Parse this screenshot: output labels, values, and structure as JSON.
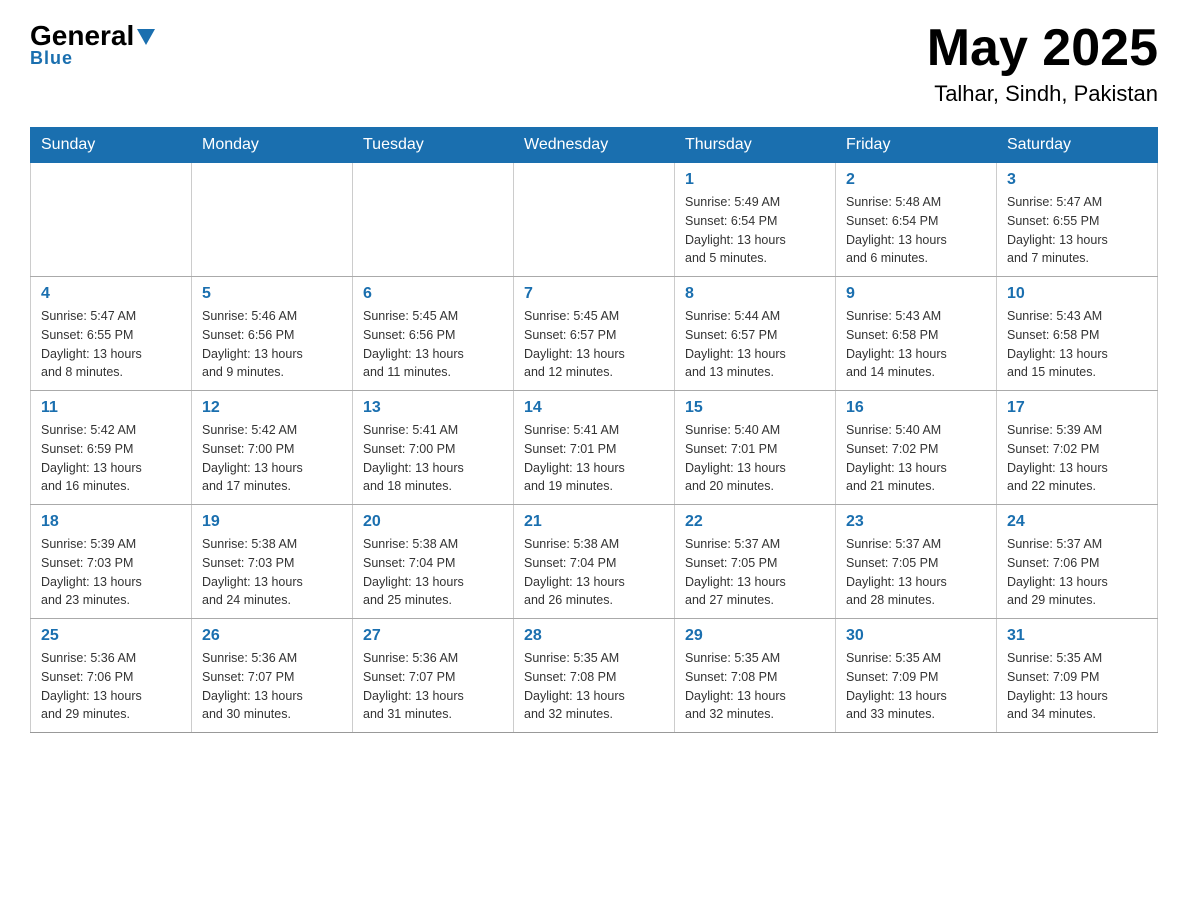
{
  "header": {
    "logo_general": "General",
    "logo_blue": "Blue",
    "month_year": "May 2025",
    "location": "Talhar, Sindh, Pakistan"
  },
  "calendar": {
    "days_of_week": [
      "Sunday",
      "Monday",
      "Tuesday",
      "Wednesday",
      "Thursday",
      "Friday",
      "Saturday"
    ],
    "weeks": [
      [
        {
          "day": "",
          "info": ""
        },
        {
          "day": "",
          "info": ""
        },
        {
          "day": "",
          "info": ""
        },
        {
          "day": "",
          "info": ""
        },
        {
          "day": "1",
          "info": "Sunrise: 5:49 AM\nSunset: 6:54 PM\nDaylight: 13 hours\nand 5 minutes."
        },
        {
          "day": "2",
          "info": "Sunrise: 5:48 AM\nSunset: 6:54 PM\nDaylight: 13 hours\nand 6 minutes."
        },
        {
          "day": "3",
          "info": "Sunrise: 5:47 AM\nSunset: 6:55 PM\nDaylight: 13 hours\nand 7 minutes."
        }
      ],
      [
        {
          "day": "4",
          "info": "Sunrise: 5:47 AM\nSunset: 6:55 PM\nDaylight: 13 hours\nand 8 minutes."
        },
        {
          "day": "5",
          "info": "Sunrise: 5:46 AM\nSunset: 6:56 PM\nDaylight: 13 hours\nand 9 minutes."
        },
        {
          "day": "6",
          "info": "Sunrise: 5:45 AM\nSunset: 6:56 PM\nDaylight: 13 hours\nand 11 minutes."
        },
        {
          "day": "7",
          "info": "Sunrise: 5:45 AM\nSunset: 6:57 PM\nDaylight: 13 hours\nand 12 minutes."
        },
        {
          "day": "8",
          "info": "Sunrise: 5:44 AM\nSunset: 6:57 PM\nDaylight: 13 hours\nand 13 minutes."
        },
        {
          "day": "9",
          "info": "Sunrise: 5:43 AM\nSunset: 6:58 PM\nDaylight: 13 hours\nand 14 minutes."
        },
        {
          "day": "10",
          "info": "Sunrise: 5:43 AM\nSunset: 6:58 PM\nDaylight: 13 hours\nand 15 minutes."
        }
      ],
      [
        {
          "day": "11",
          "info": "Sunrise: 5:42 AM\nSunset: 6:59 PM\nDaylight: 13 hours\nand 16 minutes."
        },
        {
          "day": "12",
          "info": "Sunrise: 5:42 AM\nSunset: 7:00 PM\nDaylight: 13 hours\nand 17 minutes."
        },
        {
          "day": "13",
          "info": "Sunrise: 5:41 AM\nSunset: 7:00 PM\nDaylight: 13 hours\nand 18 minutes."
        },
        {
          "day": "14",
          "info": "Sunrise: 5:41 AM\nSunset: 7:01 PM\nDaylight: 13 hours\nand 19 minutes."
        },
        {
          "day": "15",
          "info": "Sunrise: 5:40 AM\nSunset: 7:01 PM\nDaylight: 13 hours\nand 20 minutes."
        },
        {
          "day": "16",
          "info": "Sunrise: 5:40 AM\nSunset: 7:02 PM\nDaylight: 13 hours\nand 21 minutes."
        },
        {
          "day": "17",
          "info": "Sunrise: 5:39 AM\nSunset: 7:02 PM\nDaylight: 13 hours\nand 22 minutes."
        }
      ],
      [
        {
          "day": "18",
          "info": "Sunrise: 5:39 AM\nSunset: 7:03 PM\nDaylight: 13 hours\nand 23 minutes."
        },
        {
          "day": "19",
          "info": "Sunrise: 5:38 AM\nSunset: 7:03 PM\nDaylight: 13 hours\nand 24 minutes."
        },
        {
          "day": "20",
          "info": "Sunrise: 5:38 AM\nSunset: 7:04 PM\nDaylight: 13 hours\nand 25 minutes."
        },
        {
          "day": "21",
          "info": "Sunrise: 5:38 AM\nSunset: 7:04 PM\nDaylight: 13 hours\nand 26 minutes."
        },
        {
          "day": "22",
          "info": "Sunrise: 5:37 AM\nSunset: 7:05 PM\nDaylight: 13 hours\nand 27 minutes."
        },
        {
          "day": "23",
          "info": "Sunrise: 5:37 AM\nSunset: 7:05 PM\nDaylight: 13 hours\nand 28 minutes."
        },
        {
          "day": "24",
          "info": "Sunrise: 5:37 AM\nSunset: 7:06 PM\nDaylight: 13 hours\nand 29 minutes."
        }
      ],
      [
        {
          "day": "25",
          "info": "Sunrise: 5:36 AM\nSunset: 7:06 PM\nDaylight: 13 hours\nand 29 minutes."
        },
        {
          "day": "26",
          "info": "Sunrise: 5:36 AM\nSunset: 7:07 PM\nDaylight: 13 hours\nand 30 minutes."
        },
        {
          "day": "27",
          "info": "Sunrise: 5:36 AM\nSunset: 7:07 PM\nDaylight: 13 hours\nand 31 minutes."
        },
        {
          "day": "28",
          "info": "Sunrise: 5:35 AM\nSunset: 7:08 PM\nDaylight: 13 hours\nand 32 minutes."
        },
        {
          "day": "29",
          "info": "Sunrise: 5:35 AM\nSunset: 7:08 PM\nDaylight: 13 hours\nand 32 minutes."
        },
        {
          "day": "30",
          "info": "Sunrise: 5:35 AM\nSunset: 7:09 PM\nDaylight: 13 hours\nand 33 minutes."
        },
        {
          "day": "31",
          "info": "Sunrise: 5:35 AM\nSunset: 7:09 PM\nDaylight: 13 hours\nand 34 minutes."
        }
      ]
    ]
  }
}
